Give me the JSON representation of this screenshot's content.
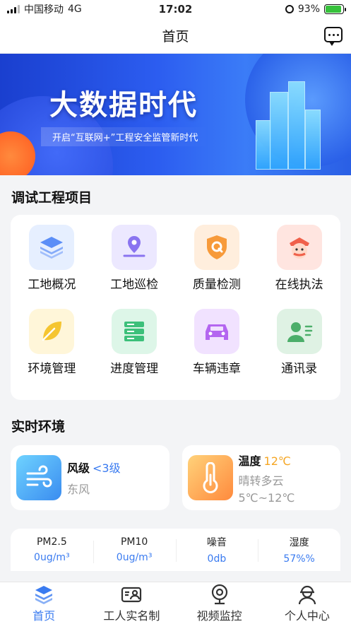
{
  "status_bar": {
    "carrier": "中国移动",
    "network": "4G",
    "time": "17:02",
    "battery": "93%"
  },
  "nav": {
    "title": "首页"
  },
  "banner": {
    "title": "大数据时代",
    "subtitle": "开启“互联网+”工程安全监管新时代"
  },
  "projects": {
    "title": "调试工程项目",
    "items": [
      {
        "label": "工地概况",
        "icon": "layers-icon",
        "bg": "#e6efff",
        "color": "#5b8ef7"
      },
      {
        "label": "工地巡检",
        "icon": "location-pin-icon",
        "bg": "#ece8ff",
        "color": "#8a74f0"
      },
      {
        "label": "质量检测",
        "icon": "shield-q-icon",
        "bg": "#ffeedd",
        "color": "#f79a3a"
      },
      {
        "label": "在线执法",
        "icon": "officer-icon",
        "bg": "#ffe5e0",
        "color": "#f0604a"
      },
      {
        "label": "环境管理",
        "icon": "leaf-icon",
        "bg": "#fff6d9",
        "color": "#f5c531"
      },
      {
        "label": "进度管理",
        "icon": "server-icon",
        "bg": "#ddf6e8",
        "color": "#3cc07a"
      },
      {
        "label": "车辆违章",
        "icon": "car-icon",
        "bg": "#f1e2ff",
        "color": "#b466f0"
      },
      {
        "label": "通讯录",
        "icon": "contact-card-icon",
        "bg": "#dff2e4",
        "color": "#4cae6a"
      }
    ]
  },
  "environment": {
    "title": "实时环境",
    "wind": {
      "label": "风级",
      "level": "<3级",
      "direction": "东风"
    },
    "temperature": {
      "label": "温度",
      "value": "12℃",
      "weather": "晴转多云",
      "range": "5℃~12℃"
    }
  },
  "metrics": [
    {
      "name": "PM2.5",
      "value": "0ug/m³"
    },
    {
      "name": "PM10",
      "value": "0ug/m³"
    },
    {
      "name": "噪音",
      "value": "0db"
    },
    {
      "name": "湿度",
      "value": "57%%"
    }
  ],
  "tabbar": [
    {
      "label": "首页",
      "icon": "home-stack-icon",
      "active": true
    },
    {
      "label": "工人实名制",
      "icon": "id-card-icon",
      "active": false
    },
    {
      "label": "视频监控",
      "icon": "camera-icon",
      "active": false
    },
    {
      "label": "个人中心",
      "icon": "worker-helmet-icon",
      "active": false
    }
  ],
  "colors": {
    "accent": "#3a7bf0",
    "wind_level": "#3a7bf0",
    "temp_value": "#f5a623"
  }
}
